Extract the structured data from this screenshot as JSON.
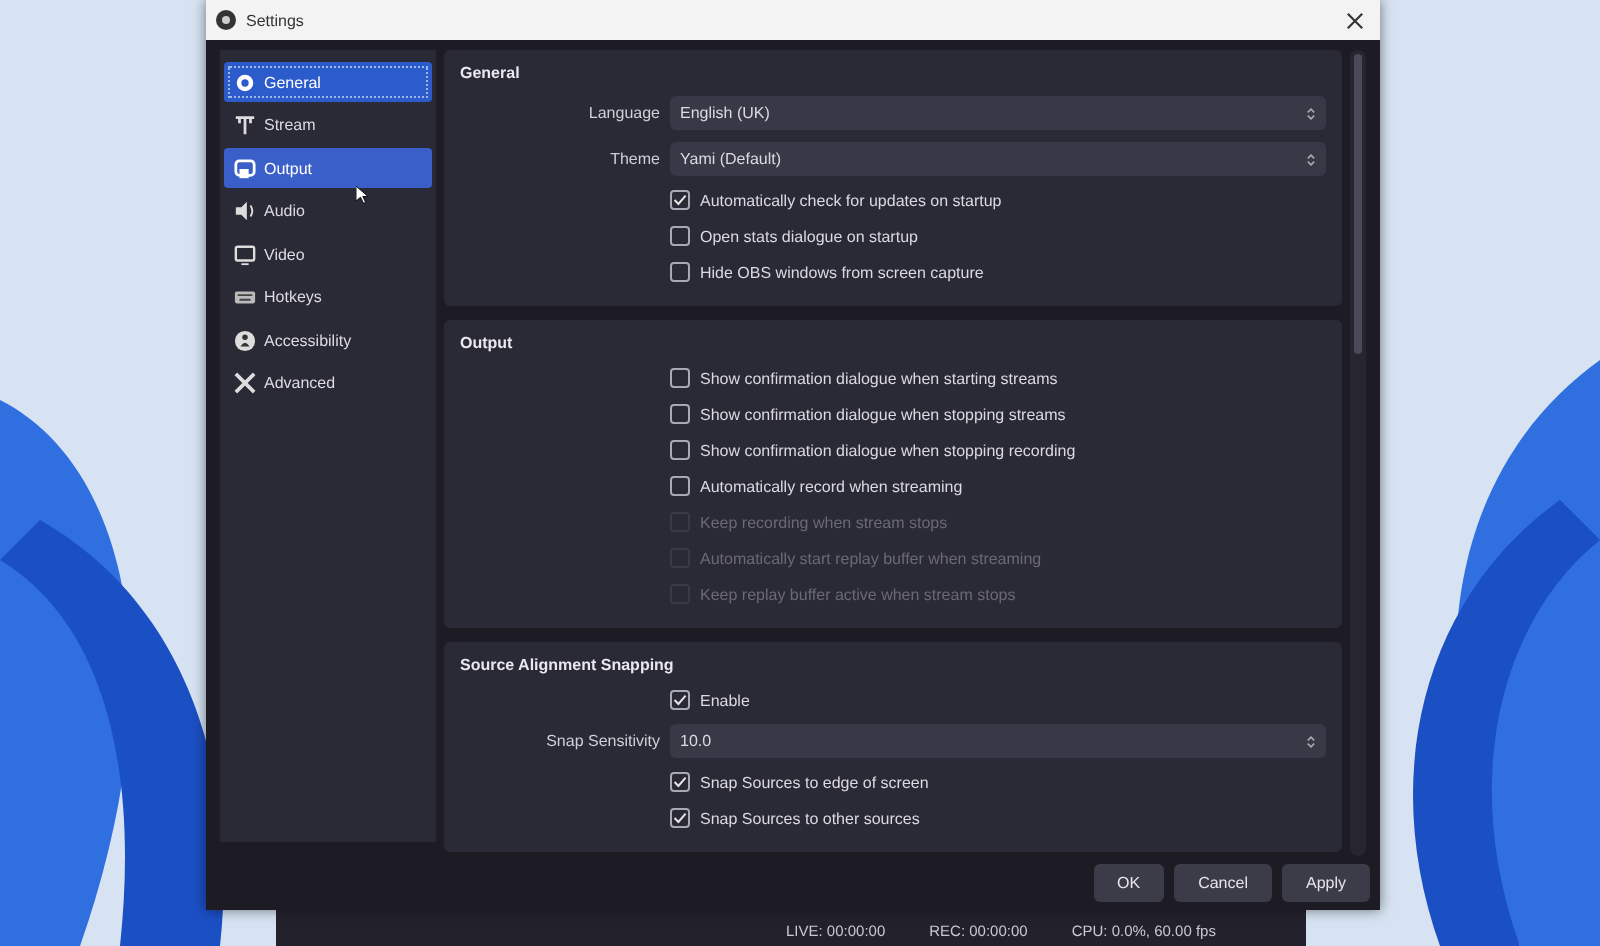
{
  "window": {
    "title": "Settings"
  },
  "sidebar": {
    "items": [
      {
        "label": "General",
        "selected": true,
        "hovered": false
      },
      {
        "label": "Stream",
        "selected": false,
        "hovered": false
      },
      {
        "label": "Output",
        "selected": false,
        "hovered": true
      },
      {
        "label": "Audio",
        "selected": false,
        "hovered": false
      },
      {
        "label": "Video",
        "selected": false,
        "hovered": false
      },
      {
        "label": "Hotkeys",
        "selected": false,
        "hovered": false
      },
      {
        "label": "Accessibility",
        "selected": false,
        "hovered": false
      },
      {
        "label": "Advanced",
        "selected": false,
        "hovered": false
      }
    ]
  },
  "sections": [
    {
      "title": "General",
      "rows": [
        {
          "kind": "select",
          "label": "Language",
          "value": "English (UK)"
        },
        {
          "kind": "select",
          "label": "Theme",
          "value": "Yami (Default)"
        },
        {
          "kind": "checkbox",
          "label": "Automatically check for updates on startup",
          "checked": true,
          "disabled": false
        },
        {
          "kind": "checkbox",
          "label": "Open stats dialogue on startup",
          "checked": false,
          "disabled": false
        },
        {
          "kind": "checkbox",
          "label": "Hide OBS windows from screen capture",
          "checked": false,
          "disabled": false
        }
      ]
    },
    {
      "title": "Output",
      "rows": [
        {
          "kind": "checkbox",
          "label": "Show confirmation dialogue when starting streams",
          "checked": false,
          "disabled": false
        },
        {
          "kind": "checkbox",
          "label": "Show confirmation dialogue when stopping streams",
          "checked": false,
          "disabled": false
        },
        {
          "kind": "checkbox",
          "label": "Show confirmation dialogue when stopping recording",
          "checked": false,
          "disabled": false
        },
        {
          "kind": "checkbox",
          "label": "Automatically record when streaming",
          "checked": false,
          "disabled": false
        },
        {
          "kind": "checkbox",
          "label": "Keep recording when stream stops",
          "checked": false,
          "disabled": true
        },
        {
          "kind": "checkbox",
          "label": "Automatically start replay buffer when streaming",
          "checked": false,
          "disabled": true
        },
        {
          "kind": "checkbox",
          "label": "Keep replay buffer active when stream stops",
          "checked": false,
          "disabled": true
        }
      ]
    },
    {
      "title": "Source Alignment Snapping",
      "rows": [
        {
          "kind": "checkbox",
          "label": "Enable",
          "checked": true,
          "disabled": false
        },
        {
          "kind": "spinbox",
          "label": "Snap Sensitivity",
          "value": "10.0"
        },
        {
          "kind": "checkbox",
          "label": "Snap Sources to edge of screen",
          "checked": true,
          "disabled": false
        },
        {
          "kind": "checkbox",
          "label": "Snap Sources to other sources",
          "checked": true,
          "disabled": false
        }
      ]
    }
  ],
  "buttons": [
    "OK",
    "Cancel",
    "Apply"
  ],
  "background_status": [
    "LIVE: 00:00:00",
    "REC: 00:00:00",
    "CPU: 0.0%, 60.00 fps"
  ]
}
